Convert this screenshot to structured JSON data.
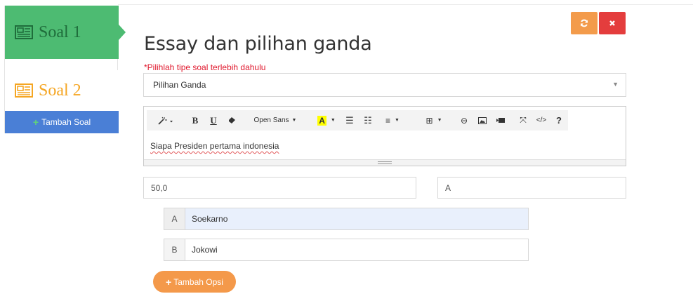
{
  "sidebar": {
    "items": [
      {
        "label": "Soal 1",
        "state": "active",
        "color": "#4dbb72"
      },
      {
        "label": "Soal 2",
        "state": "inactive",
        "color": "#f5a623"
      }
    ],
    "add_button_label": "Tambah Soal",
    "add_button_color": "#4a7fd6"
  },
  "header": {
    "title": "Essay dan pilihan ganda",
    "warning": "*Pilihlah tipe soal terlebih dahulu",
    "refresh_icon": "refresh-icon",
    "close_icon": "close-icon"
  },
  "question_type": {
    "selected": "Pilihan Ganda"
  },
  "editor": {
    "font_label": "Open Sans",
    "content": "Siapa Presiden pertama indonesia",
    "tools": [
      "magic-icon",
      "bold-icon",
      "underline-icon",
      "eraser-icon",
      "font-family-dropdown",
      "font-color-icon",
      "unordered-list-icon",
      "ordered-list-icon",
      "align-icon",
      "table-icon",
      "link-icon",
      "image-icon",
      "video-icon",
      "fullscreen-icon",
      "code-view-icon",
      "help-icon"
    ]
  },
  "score": {
    "value": "50,0"
  },
  "answer_key": {
    "value": "A"
  },
  "options": [
    {
      "letter": "A",
      "text": "Soekarno"
    },
    {
      "letter": "B",
      "text": "Jokowi"
    }
  ],
  "add_option_label": "Tambah Opsi",
  "colors": {
    "accent_orange": "#f39b4b",
    "danger_red": "#e43d3d",
    "warning_text": "#e0182d"
  }
}
